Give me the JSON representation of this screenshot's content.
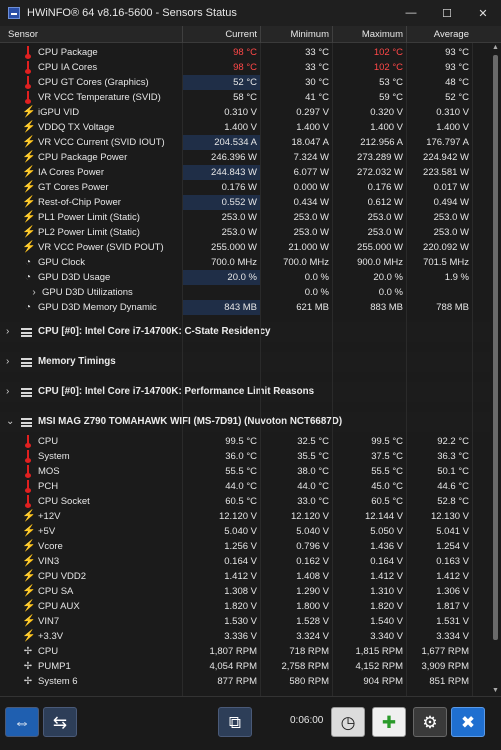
{
  "window": {
    "title": "HWiNFO® 64 v8.16-5600 - Sensors Status",
    "minimize": "—",
    "maximize": "☐",
    "close": "✕"
  },
  "columns": {
    "sensor": "Sensor",
    "current": "Current",
    "minimum": "Minimum",
    "maximum": "Maximum",
    "average": "Average"
  },
  "rows": [
    {
      "label": "CPU Package",
      "icon": "thermometer-icon",
      "current": "98 °C",
      "minimum": "33 °C",
      "maximum": "102 °C",
      "average": "93 °C",
      "red_current": true,
      "red_max": true
    },
    {
      "label": "CPU IA Cores",
      "icon": "thermometer-icon",
      "current": "98 °C",
      "minimum": "33 °C",
      "maximum": "102 °C",
      "average": "93 °C",
      "red_current": true,
      "red_max": true
    },
    {
      "label": "CPU GT Cores (Graphics)",
      "icon": "thermometer-icon",
      "current": "52 °C",
      "minimum": "30 °C",
      "maximum": "53 °C",
      "average": "48 °C",
      "hl": true
    },
    {
      "label": "VR VCC Temperature (SVID)",
      "icon": "thermometer-icon",
      "current": "58 °C",
      "minimum": "41 °C",
      "maximum": "59 °C",
      "average": "52 °C"
    },
    {
      "label": "iGPU VID",
      "icon": "voltage-icon",
      "current": "0.310 V",
      "minimum": "0.297 V",
      "maximum": "0.320 V",
      "average": "0.310 V"
    },
    {
      "label": "VDDQ TX Voltage",
      "icon": "voltage-icon",
      "current": "1.400 V",
      "minimum": "1.400 V",
      "maximum": "1.400 V",
      "average": "1.400 V"
    },
    {
      "label": "VR VCC Current (SVID IOUT)",
      "icon": "voltage-icon",
      "current": "204.534 A",
      "minimum": "18.047 A",
      "maximum": "212.956 A",
      "average": "176.797 A",
      "hl": true
    },
    {
      "label": "CPU Package Power",
      "icon": "voltage-icon",
      "current": "246.396 W",
      "minimum": "7.324 W",
      "maximum": "273.289 W",
      "average": "224.942 W"
    },
    {
      "label": "IA Cores Power",
      "icon": "voltage-icon",
      "current": "244.843 W",
      "minimum": "6.077 W",
      "maximum": "272.032 W",
      "average": "223.581 W",
      "hl": true
    },
    {
      "label": "GT Cores Power",
      "icon": "voltage-icon",
      "current": "0.176 W",
      "minimum": "0.000 W",
      "maximum": "0.176 W",
      "average": "0.017 W"
    },
    {
      "label": "Rest-of-Chip Power",
      "icon": "voltage-icon",
      "current": "0.552 W",
      "minimum": "0.434 W",
      "maximum": "0.612 W",
      "average": "0.494 W",
      "hl": true
    },
    {
      "label": "PL1 Power Limit (Static)",
      "icon": "voltage-icon",
      "current": "253.0 W",
      "minimum": "253.0 W",
      "maximum": "253.0 W",
      "average": "253.0 W"
    },
    {
      "label": "PL2 Power Limit (Static)",
      "icon": "voltage-icon",
      "current": "253.0 W",
      "minimum": "253.0 W",
      "maximum": "253.0 W",
      "average": "253.0 W"
    },
    {
      "label": "VR VCC Power (SVID POUT)",
      "icon": "voltage-icon",
      "current": "255.000 W",
      "minimum": "21.000 W",
      "maximum": "255.000 W",
      "average": "220.092 W"
    },
    {
      "label": "GPU Clock",
      "icon": "clock-icon",
      "current": "700.0 MHz",
      "minimum": "700.0 MHz",
      "maximum": "900.0 MHz",
      "average": "701.5 MHz"
    },
    {
      "label": "GPU D3D Usage",
      "icon": "clock-icon",
      "current": "20.0 %",
      "minimum": "0.0 %",
      "maximum": "20.0 %",
      "average": "1.9 %",
      "hl": true
    },
    {
      "label": "GPU D3D Utilizations",
      "icon": "chevron-right-icon",
      "current": "",
      "minimum": "0.0 %",
      "maximum": "0.0 %",
      "average": "",
      "indent": true
    },
    {
      "label": "GPU D3D Memory Dynamic",
      "icon": "clock-icon",
      "current": "843 MB",
      "minimum": "621 MB",
      "maximum": "883 MB",
      "average": "788 MB",
      "hl": true
    }
  ],
  "sections": [
    {
      "title": "CPU [#0]: Intel Core i7-14700K: C-State Residency"
    },
    {
      "title": "Memory Timings"
    },
    {
      "title": "CPU [#0]: Intel Core i7-14700K: Performance Limit Reasons"
    },
    {
      "title": "MSI MAG Z790 TOMAHAWK WIFI (MS-7D91) (Nuvoton NCT6687D)"
    }
  ],
  "mobo_rows": [
    {
      "label": "CPU",
      "icon": "thermometer-icon",
      "current": "99.5 °C",
      "minimum": "32.5 °C",
      "maximum": "99.5 °C",
      "average": "92.2 °C"
    },
    {
      "label": "System",
      "icon": "thermometer-icon",
      "current": "36.0 °C",
      "minimum": "35.5 °C",
      "maximum": "37.5 °C",
      "average": "36.3 °C"
    },
    {
      "label": "MOS",
      "icon": "thermometer-icon",
      "current": "55.5 °C",
      "minimum": "38.0 °C",
      "maximum": "55.5 °C",
      "average": "50.1 °C"
    },
    {
      "label": "PCH",
      "icon": "thermometer-icon",
      "current": "44.0 °C",
      "minimum": "44.0 °C",
      "maximum": "45.0 °C",
      "average": "44.6 °C"
    },
    {
      "label": "CPU Socket",
      "icon": "thermometer-icon",
      "current": "60.5 °C",
      "minimum": "33.0 °C",
      "maximum": "60.5 °C",
      "average": "52.8 °C"
    },
    {
      "label": "+12V",
      "icon": "voltage-icon",
      "current": "12.120 V",
      "minimum": "12.120 V",
      "maximum": "12.144 V",
      "average": "12.130 V"
    },
    {
      "label": "+5V",
      "icon": "voltage-icon",
      "current": "5.040 V",
      "minimum": "5.040 V",
      "maximum": "5.050 V",
      "average": "5.041 V"
    },
    {
      "label": "Vcore",
      "icon": "voltage-icon",
      "current": "1.256 V",
      "minimum": "0.796 V",
      "maximum": "1.436 V",
      "average": "1.254 V"
    },
    {
      "label": "VIN3",
      "icon": "voltage-icon",
      "current": "0.164 V",
      "minimum": "0.162 V",
      "maximum": "0.164 V",
      "average": "0.163 V"
    },
    {
      "label": "CPU VDD2",
      "icon": "voltage-icon",
      "current": "1.412 V",
      "minimum": "1.408 V",
      "maximum": "1.412 V",
      "average": "1.412 V"
    },
    {
      "label": "CPU SA",
      "icon": "voltage-icon",
      "current": "1.308 V",
      "minimum": "1.290 V",
      "maximum": "1.310 V",
      "average": "1.306 V"
    },
    {
      "label": "CPU AUX",
      "icon": "voltage-icon",
      "current": "1.820 V",
      "minimum": "1.800 V",
      "maximum": "1.820 V",
      "average": "1.817 V"
    },
    {
      "label": "VIN7",
      "icon": "voltage-icon",
      "current": "1.530 V",
      "minimum": "1.528 V",
      "maximum": "1.540 V",
      "average": "1.531 V"
    },
    {
      "label": "+3.3V",
      "icon": "voltage-icon",
      "current": "3.336 V",
      "minimum": "3.324 V",
      "maximum": "3.340 V",
      "average": "3.334 V"
    },
    {
      "label": "CPU",
      "icon": "fan-icon",
      "current": "1,807 RPM",
      "minimum": "718 RPM",
      "maximum": "1,815 RPM",
      "average": "1,677 RPM"
    },
    {
      "label": "PUMP1",
      "icon": "fan-icon",
      "current": "4,054 RPM",
      "minimum": "2,758 RPM",
      "maximum": "4,152 RPM",
      "average": "3,909 RPM"
    },
    {
      "label": "System 6",
      "icon": "fan-icon",
      "current": "877 RPM",
      "minimum": "580 RPM",
      "maximum": "904 RPM",
      "average": "851 RPM"
    }
  ],
  "toolbar": {
    "elapsed": "0:06:00"
  }
}
